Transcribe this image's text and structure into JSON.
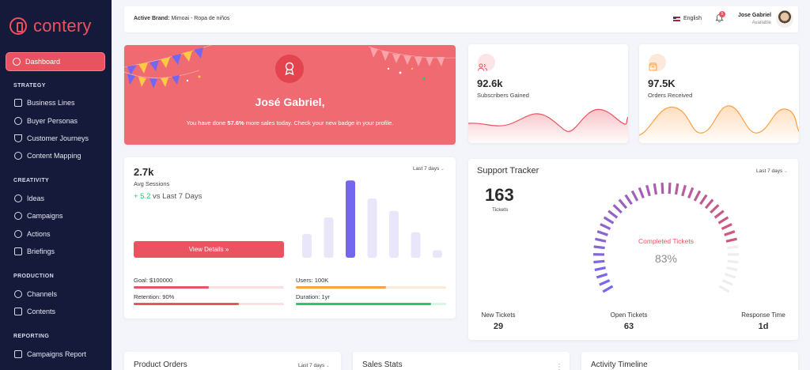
{
  "sidebar": {
    "brand": "contery",
    "active_item": "Dashboard",
    "sections": [
      {
        "title": "STRATEGY",
        "items": [
          "Business Lines",
          "Buyer Personas",
          "Customer Journeys",
          "Content Mapping"
        ]
      },
      {
        "title": "CREATIVITY",
        "items": [
          "Ideas",
          "Campaigns",
          "Actions",
          "Briefings"
        ]
      },
      {
        "title": "PRODUCTION",
        "items": [
          "Channels",
          "Contents"
        ]
      },
      {
        "title": "REPORTING",
        "items": [
          "Campaigns Report"
        ]
      }
    ]
  },
  "topbar": {
    "brand_prefix": "Active Brand:",
    "brand_value": "Mimoai - Ropa de niños",
    "language": "English",
    "notifications": "5",
    "user_name": "Jose Gabriel",
    "user_status": "Available"
  },
  "hero": {
    "title": "José Gabriel,",
    "text_before": "You have done ",
    "text_highlight": "57.6%",
    "text_after": " more sales today. Check your new badge in your profile."
  },
  "subscribers": {
    "value": "92.6k",
    "label": "Subscribers Gained",
    "color": "#ea5460"
  },
  "orders": {
    "value": "97.5K",
    "label": "Orders Received",
    "color": "#ff9f43"
  },
  "sessions": {
    "value": "2.7k",
    "label": "Avg Sessions",
    "delta": "+ 5.2",
    "delta_suffix": " vs Last 7 Days",
    "range": "Last 7 days",
    "button": "View Details »",
    "bars": [
      0.29,
      0.49,
      0.94,
      0.72,
      0.57,
      0.31,
      0.09
    ],
    "bar_color": "#e9e6fa",
    "bar_active_color": "#7367f0",
    "metrics": [
      {
        "label": "Goal: $100000",
        "progress": 0.5,
        "color": "#ea5460",
        "track": "#fbe0e2"
      },
      {
        "label": "Users: 100K",
        "progress": 0.6,
        "color": "#ff9f43",
        "track": "#fdebd9"
      },
      {
        "label": "Retention: 90%",
        "progress": 0.7,
        "color": "#ea5460",
        "track": "#fbe0e2"
      },
      {
        "label": "Duration: 1yr",
        "progress": 0.9,
        "color": "#28c76f",
        "track": "#d9f5e6"
      }
    ]
  },
  "support": {
    "title": "Support Tracker",
    "range": "Last 7 days",
    "total": "163",
    "total_label": "Tickets",
    "gauge_label": "Completed Tickets",
    "gauge_value": "83%",
    "gauge_fraction": 0.83,
    "stats": [
      {
        "name": "New Tickets",
        "value": "29"
      },
      {
        "name": "Open Tickets",
        "value": "63"
      },
      {
        "name": "Response Time",
        "value": "1d"
      }
    ]
  },
  "bottom": {
    "product_orders": "Product Orders",
    "product_range": "Last 7 days",
    "sales_stats": "Sales Stats",
    "activity": "Activity Timeline"
  }
}
